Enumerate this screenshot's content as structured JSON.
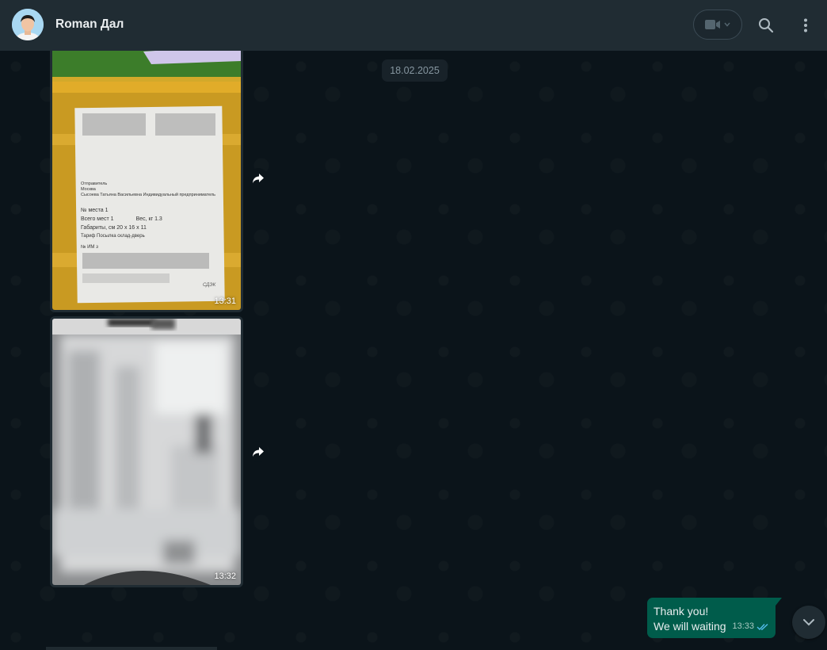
{
  "header": {
    "contact_name": "Roman Дал",
    "icons": [
      "video-camera-icon",
      "chevron-down-icon",
      "search-icon",
      "kebab-menu-icon"
    ]
  },
  "chat": {
    "date_chip": "18.02.2025",
    "messages": [
      {
        "type": "image",
        "direction": "incoming",
        "time": "13:31",
        "label_lines": [
          "Отправитель",
          "Москва",
          "Сысоева Татьяна Васильевна Индивидуальный предприниматель",
          "№ места 1",
          "Всего мест 1",
          "Вес, кг 1.3",
          "Габариты, см 20 x 16 x 11",
          "Тариф Посылка склад-дверь",
          "№ ИМ з",
          "СДЭК"
        ]
      },
      {
        "type": "image",
        "direction": "incoming",
        "time": "13:32"
      },
      {
        "type": "text",
        "direction": "outgoing",
        "lines": [
          "Thank you!",
          "We will waiting"
        ],
        "time": "13:33",
        "status_icon": "double-check-icon"
      }
    ]
  },
  "colors": {
    "header_bg": "#202c33",
    "chat_bg": "#0b141a",
    "outgoing_bubble": "#005c4b",
    "read_tick": "#53bdeb",
    "box_tape": "#d9a520"
  }
}
